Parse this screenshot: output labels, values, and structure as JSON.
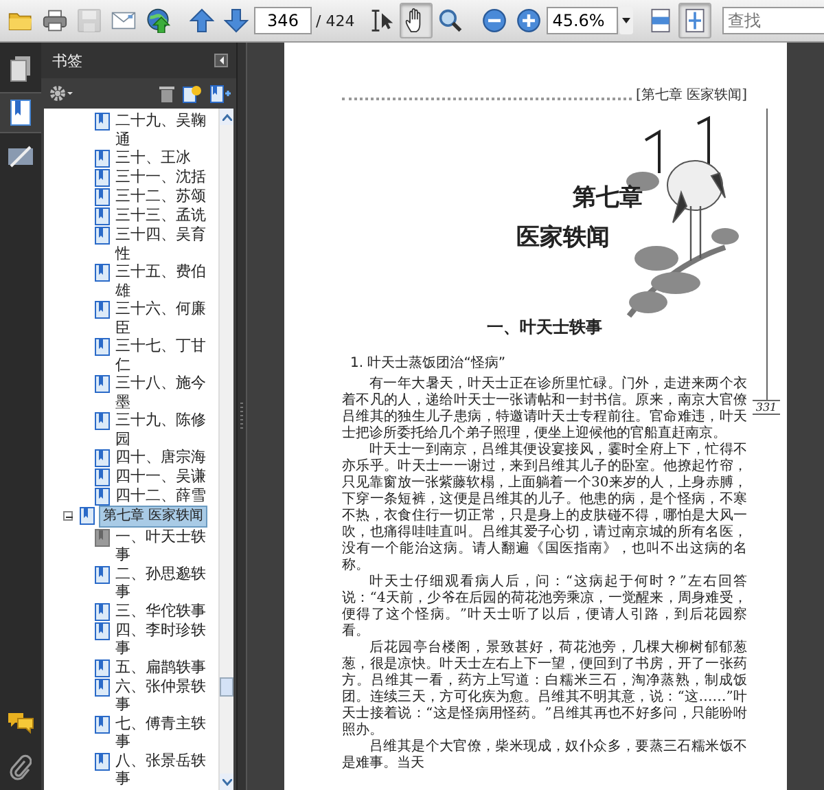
{
  "toolbar": {
    "file_tools": [
      {
        "kind": "open",
        "disabled": false
      },
      {
        "kind": "print",
        "disabled": false
      },
      {
        "kind": "save",
        "disabled": true
      },
      {
        "kind": "email",
        "disabled": false
      },
      {
        "kind": "collaborate",
        "disabled": false
      }
    ],
    "page": {
      "value": "346",
      "total": "/ 424"
    },
    "tools": [
      {
        "kind": "select-text",
        "selected": false
      },
      {
        "kind": "hand",
        "selected": true
      },
      {
        "kind": "marquee-zoom",
        "selected": false
      }
    ],
    "zoom": {
      "value": "45.6%"
    },
    "fit": [
      {
        "kind": "fit-width",
        "selected": false
      },
      {
        "kind": "fit-page",
        "selected": true
      }
    ],
    "search": {
      "placeholder": "查找"
    }
  },
  "nav_panels": [
    {
      "kind": "pages",
      "selected": false
    },
    {
      "kind": "bookmarks",
      "selected": true
    },
    {
      "kind": "signatures",
      "selected": false
    }
  ],
  "nav_bottom": [
    {
      "kind": "comments"
    },
    {
      "kind": "attachments"
    }
  ],
  "bookmarks": {
    "title": "书签",
    "earlier_items": [
      {
        "label": "二十九、吴鞠通",
        "current": false
      },
      {
        "label": "三十、王冰",
        "current": false
      },
      {
        "label": "三十一、沈括",
        "current": false
      },
      {
        "label": "三十二、苏颂",
        "current": false
      },
      {
        "label": "三十三、孟诜",
        "current": false
      },
      {
        "label": "三十四、吴育性",
        "current": false
      },
      {
        "label": "三十五、费伯雄",
        "current": false
      },
      {
        "label": "三十六、何廉臣",
        "current": false
      },
      {
        "label": "三十七、丁甘仁",
        "current": false
      },
      {
        "label": "三十八、施今墨",
        "current": false
      },
      {
        "label": "三十九、陈修园",
        "current": false
      },
      {
        "label": "四十、唐宗海",
        "current": false
      },
      {
        "label": "四十一、吴谦",
        "current": false
      },
      {
        "label": "四十二、薛雪",
        "current": false
      }
    ],
    "chapters": [
      {
        "label": "第七章 医家轶闻",
        "expanded": true,
        "selected": true,
        "children": [
          {
            "label": "一、叶天士轶事",
            "current": true
          },
          {
            "label": "二、孙思邈轶事",
            "current": false
          },
          {
            "label": "三、华佗轶事",
            "current": false
          },
          {
            "label": "四、李时珍轶事",
            "current": false
          },
          {
            "label": "五、扁鹊轶事",
            "current": false
          },
          {
            "label": "六、张仲景轶事",
            "current": false
          },
          {
            "label": "七、傅青主轶事",
            "current": false
          },
          {
            "label": "八、张景岳轶事",
            "current": false
          }
        ]
      }
    ]
  },
  "page": {
    "running_head": "[第七章  医家轶闻]",
    "chapter_number": "第七章",
    "chapter_title": "医家轶闻",
    "section_title": "一、叶天士轶事",
    "subsection_title": "1. 叶天士蒸饭团治“怪病”",
    "page_number": "331",
    "paragraphs": [
      "有一年大暑天，叶天士正在诊所里忙碌。门外，走进来两个衣着不凡的人，递给叶天士一张请帖和一封书信。原来，南京大官僚吕维其的独生儿子患病，特邀请叶天士专程前往。官命难违，叶天士把诊所委托给几个弟子照理，便坐上迎候他的官船直赶南京。",
      "叶天士一到南京，吕维其便设宴接风，霎时全府上下，忙得不亦乐乎。叶天士一一谢过，来到吕维其儿子的卧室。他撩起竹帘，只见靠窗放一张紫藤软榻，上面躺着一个30来岁的人，上身赤膊，下穿一条短裤，这便是吕维其的儿子。他患的病，是个怪病，不寒不热，衣食住行一切正常，只是身上的皮肤碰不得，哪怕是大风一吹，也痛得哇哇直叫。吕维其爱子心切，请过南京城的所有名医，没有一个能治这病。请人翻遍《国医指南》，也叫不出这病的名称。",
      "叶天士仔细观看病人后，问：“这病起于何时？”左右回答说：“4天前，少爷在后园的荷花池旁乘凉，一觉醒来，周身难受，便得了这个怪病。”叶天士听了以后，便请人引路，到后花园察看。",
      "后花园亭台楼阁，景致甚好，荷花池旁，几棵大柳树郁郁葱葱，很是凉快。叶天士左右上下一望，便回到了书房，开了一张药方。吕维其一看，药方上写道：白糯米三石，淘净蒸熟，制成饭团。连续三天，方可化疾为愈。吕维其不明其意，说：“这……”叶天士接着说：“这是怪病用怪药。”吕维其再也不好多问，只能吩咐照办。",
      "吕维其是个大官僚，柴米现成，奴仆众多，要蒸三石糯米饭不是难事。当天"
    ]
  }
}
